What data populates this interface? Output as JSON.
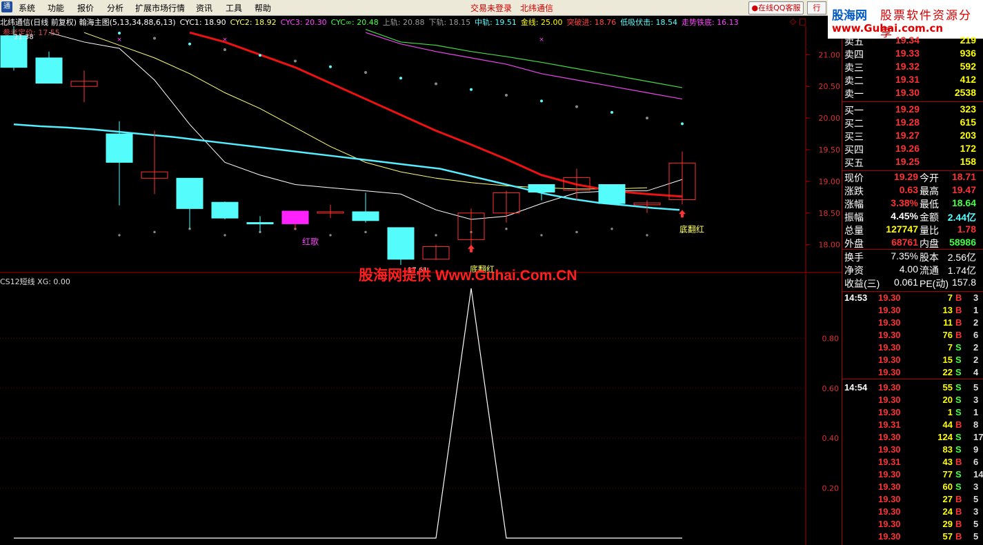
{
  "menu": {
    "items": [
      "系统",
      "功能",
      "报价",
      "分析",
      "扩展市场行情",
      "资讯",
      "工具",
      "帮助"
    ],
    "login_status": "交易未登录",
    "stock_name": "北纬通信",
    "qq_button": "在线QQ客服",
    "trade_button": "行"
  },
  "logo": {
    "brand": "股海网",
    "tagline": "股票软件资源分享",
    "url": "www.Guhai.com.cn"
  },
  "info_line": [
    {
      "text": "北纬通信(日线 前复权) 翰海主图(5,13,34,88,6,13)",
      "color": "#ffffff"
    },
    {
      "text": "CYC1: 18.90",
      "color": "#ffffff"
    },
    {
      "text": "CYC2: 18.92",
      "color": "#ffff66"
    },
    {
      "text": "CYC3: 20.30",
      "color": "#ff44ff"
    },
    {
      "text": "CYC∞: 20.48",
      "color": "#44ff44"
    },
    {
      "text": "上轨: 20.88",
      "color": "#999999"
    },
    {
      "text": "下轨: 18.15",
      "color": "#999999"
    },
    {
      "text": "中轨: 19.51",
      "color": "#55ffff"
    },
    {
      "text": "金线: 25.00",
      "color": "#ffff00"
    },
    {
      "text": "突破进: 18.76",
      "color": "#ff4444"
    },
    {
      "text": "低吸伏击: 18.54",
      "color": "#55ffff"
    },
    {
      "text": "走势铁底: 16.13",
      "color": "#ff44ff"
    }
  ],
  "ref_price": "参考定价: 17.55",
  "close_icon": "◇ □",
  "chart_annotations": {
    "high_label": "21.38",
    "low_label": "17.61",
    "hongge": "红歌",
    "difanhong_1": "底翻红",
    "difanhong_2": "底翻红"
  },
  "watermark": "股海网提供 Www.Guhai.Com.CN",
  "sub_indicator_label": "CS12短线 XG: 0.00",
  "colors": {
    "up": "#ff3232",
    "down": "#54fcfc",
    "bg": "#000000",
    "axis": "#b00000"
  },
  "chart_data": [
    {
      "type": "candlestick",
      "ylim": [
        17.55,
        21.45
      ],
      "yticks": [
        18.0,
        18.5,
        19.0,
        19.5,
        20.0,
        20.5,
        21.0
      ],
      "candles": [
        {
          "o": 21.3,
          "h": 21.45,
          "l": 20.75,
          "c": 20.8
        },
        {
          "o": 20.95,
          "h": 21.05,
          "l": 20.55,
          "c": 20.55
        },
        {
          "o": 20.5,
          "h": 20.75,
          "l": 20.25,
          "c": 20.58
        },
        {
          "o": 19.75,
          "h": 19.95,
          "l": 18.62,
          "c": 19.3
        },
        {
          "o": 19.05,
          "h": 19.8,
          "l": 18.8,
          "c": 19.15
        },
        {
          "o": 19.05,
          "h": 19.05,
          "l": 18.25,
          "c": 18.57
        },
        {
          "o": 18.67,
          "h": 18.68,
          "l": 18.4,
          "c": 18.42
        },
        {
          "o": 18.35,
          "h": 18.45,
          "l": 18.2,
          "c": 18.33
        },
        {
          "o": 18.33,
          "h": 18.5,
          "l": 18.23,
          "c": 18.53
        },
        {
          "o": 18.52,
          "h": 18.63,
          "l": 18.42,
          "c": 18.52
        },
        {
          "o": 18.52,
          "h": 18.82,
          "l": 18.35,
          "c": 18.38
        },
        {
          "o": 18.27,
          "h": 18.27,
          "l": 17.68,
          "c": 17.77
        },
        {
          "o": 17.77,
          "h": 18.0,
          "l": 17.76,
          "c": 17.97
        },
        {
          "o": 18.08,
          "h": 18.57,
          "l": 17.95,
          "c": 18.5
        },
        {
          "o": 18.5,
          "h": 18.85,
          "l": 18.35,
          "c": 18.82
        },
        {
          "o": 18.95,
          "h": 18.95,
          "l": 18.7,
          "c": 18.83
        },
        {
          "o": 18.86,
          "h": 19.2,
          "l": 18.7,
          "c": 19.06
        },
        {
          "o": 18.95,
          "h": 18.95,
          "l": 18.65,
          "c": 18.65
        },
        {
          "o": 18.63,
          "h": 18.7,
          "l": 18.5,
          "c": 18.66
        },
        {
          "o": 18.71,
          "h": 19.47,
          "l": 18.64,
          "c": 19.29
        }
      ],
      "cyan_line": [
        19.9,
        19.87,
        19.85,
        19.82,
        19.78,
        19.74,
        19.7,
        19.65,
        19.6,
        19.55,
        19.5,
        19.45,
        19.4,
        19.35,
        19.3,
        19.25,
        19.2,
        19.1,
        19.0,
        18.9,
        18.8,
        18.72,
        18.66,
        18.62,
        18.58,
        18.55
      ],
      "red_line": [
        21.35,
        21.2,
        21.0,
        20.8,
        20.55,
        20.3,
        20.05,
        19.8,
        19.58,
        19.35,
        19.1,
        18.95,
        18.85,
        18.8,
        18.76
      ],
      "white_line": [
        21.35,
        21.2,
        21.1,
        20.6,
        19.9,
        19.3,
        19.1,
        18.95,
        18.9,
        18.85,
        18.8,
        18.55,
        18.4,
        18.45,
        18.65,
        18.82,
        18.85,
        18.85,
        19.03
      ],
      "yellow_line": [
        21.35,
        21.15,
        20.95,
        20.7,
        20.4,
        20.15,
        19.85,
        19.55,
        19.3,
        19.15,
        19.05,
        18.98,
        18.93,
        18.9,
        18.88,
        18.88,
        18.9
      ],
      "green_line": [
        21.4,
        21.2,
        21.15,
        21.05,
        20.97,
        20.88,
        20.78,
        20.68,
        20.58,
        20.48
      ],
      "magenta_line": [
        21.35,
        21.17,
        21.05,
        20.95,
        20.85,
        20.7,
        20.6,
        20.5,
        20.4,
        20.3
      ]
    },
    {
      "type": "line",
      "title": "CS12短线",
      "ylim": [
        0,
        1.0
      ],
      "yticks": [
        0.2,
        0.4,
        0.6,
        0.8
      ],
      "values": [
        0,
        0,
        0,
        0,
        0,
        0,
        0,
        0,
        0,
        0,
        0,
        0,
        0,
        1,
        0,
        0,
        0,
        0,
        0,
        0
      ]
    }
  ],
  "quote": {
    "asks": [
      {
        "label": "卖五",
        "price": "19.34",
        "vol": "219"
      },
      {
        "label": "卖四",
        "price": "19.33",
        "vol": "936"
      },
      {
        "label": "卖三",
        "price": "19.32",
        "vol": "592"
      },
      {
        "label": "卖二",
        "price": "19.31",
        "vol": "412"
      },
      {
        "label": "卖一",
        "price": "19.30",
        "vol": "2538"
      }
    ],
    "bids": [
      {
        "label": "买一",
        "price": "19.29",
        "vol": "323"
      },
      {
        "label": "买二",
        "price": "19.28",
        "vol": "615"
      },
      {
        "label": "买三",
        "price": "19.27",
        "vol": "203"
      },
      {
        "label": "买四",
        "price": "19.26",
        "vol": "172"
      },
      {
        "label": "买五",
        "price": "19.25",
        "vol": "158"
      }
    ],
    "stats": [
      {
        "l1": "现价",
        "v1": "19.29",
        "c1": "#ff3232",
        "l2": "今开",
        "v2": "18.71",
        "c2": "#ff3232"
      },
      {
        "l1": "涨跌",
        "v1": "0.63",
        "c1": "#ff3232",
        "l2": "最高",
        "v2": "19.47",
        "c2": "#ff3232"
      },
      {
        "l1": "涨幅",
        "v1": "3.38%",
        "c1": "#ff3232",
        "l2": "最低",
        "v2": "18.64",
        "c2": "#44ff44"
      },
      {
        "l1": "振幅",
        "v1": "4.45%",
        "c1": "#ffffff",
        "l2": "金额",
        "v2": "2.44亿",
        "c2": "#55ffff"
      },
      {
        "l1": "总量",
        "v1": "127747",
        "c1": "#ffff00",
        "l2": "量比",
        "v2": "1.78",
        "c2": "#ff3232"
      },
      {
        "l1": "外盘",
        "v1": "68761",
        "c1": "#ff3232",
        "l2": "内盘",
        "v2": "58986",
        "c2": "#44ff44"
      }
    ],
    "stats2": [
      {
        "l1": "换手",
        "v1": "7.35%",
        "c1": "#ffffff",
        "l2": "股本",
        "v2": "2.56亿",
        "c2": "#ffffff"
      },
      {
        "l1": "净资",
        "v1": "4.00",
        "c1": "#ffffff",
        "l2": "流通",
        "v2": "1.74亿",
        "c2": "#ffffff"
      },
      {
        "l1": "收益(三)",
        "v1": "0.061",
        "c1": "#ffffff",
        "l2": "PE(动)",
        "v2": "157.8",
        "c2": "#ffffff"
      }
    ],
    "ticks": [
      {
        "time": "14:53",
        "price": "19.30",
        "vol": "7",
        "bs": "B",
        "n": "3"
      },
      {
        "time": "",
        "price": "19.30",
        "vol": "13",
        "bs": "B",
        "n": "1"
      },
      {
        "time": "",
        "price": "19.30",
        "vol": "11",
        "bs": "B",
        "n": "2"
      },
      {
        "time": "",
        "price": "19.30",
        "vol": "76",
        "bs": "B",
        "n": "6"
      },
      {
        "time": "",
        "price": "19.30",
        "vol": "7",
        "bs": "S",
        "n": "2"
      },
      {
        "time": "",
        "price": "19.30",
        "vol": "15",
        "bs": "S",
        "n": "2"
      },
      {
        "time": "",
        "price": "19.30",
        "vol": "22",
        "bs": "S",
        "n": "4"
      },
      {
        "time": "14:54",
        "price": "19.30",
        "vol": "55",
        "bs": "S",
        "n": "5"
      },
      {
        "time": "",
        "price": "19.30",
        "vol": "20",
        "bs": "S",
        "n": "3"
      },
      {
        "time": "",
        "price": "19.30",
        "vol": "1",
        "bs": "S",
        "n": "1"
      },
      {
        "time": "",
        "price": "19.31",
        "vol": "44",
        "bs": "B",
        "n": "8"
      },
      {
        "time": "",
        "price": "19.30",
        "vol": "124",
        "bs": "S",
        "n": "17"
      },
      {
        "time": "",
        "price": "19.30",
        "vol": "83",
        "bs": "S",
        "n": "9"
      },
      {
        "time": "",
        "price": "19.31",
        "vol": "43",
        "bs": "B",
        "n": "6"
      },
      {
        "time": "",
        "price": "19.30",
        "vol": "77",
        "bs": "S",
        "n": "14"
      },
      {
        "time": "",
        "price": "19.30",
        "vol": "60",
        "bs": "S",
        "n": "3"
      },
      {
        "time": "",
        "price": "19.30",
        "vol": "27",
        "bs": "B",
        "n": "5"
      },
      {
        "time": "",
        "price": "19.30",
        "vol": "24",
        "bs": "B",
        "n": "3"
      },
      {
        "time": "",
        "price": "19.30",
        "vol": "29",
        "bs": "B",
        "n": "5"
      },
      {
        "time": "",
        "price": "19.30",
        "vol": "57",
        "bs": "B",
        "n": "5"
      }
    ]
  }
}
